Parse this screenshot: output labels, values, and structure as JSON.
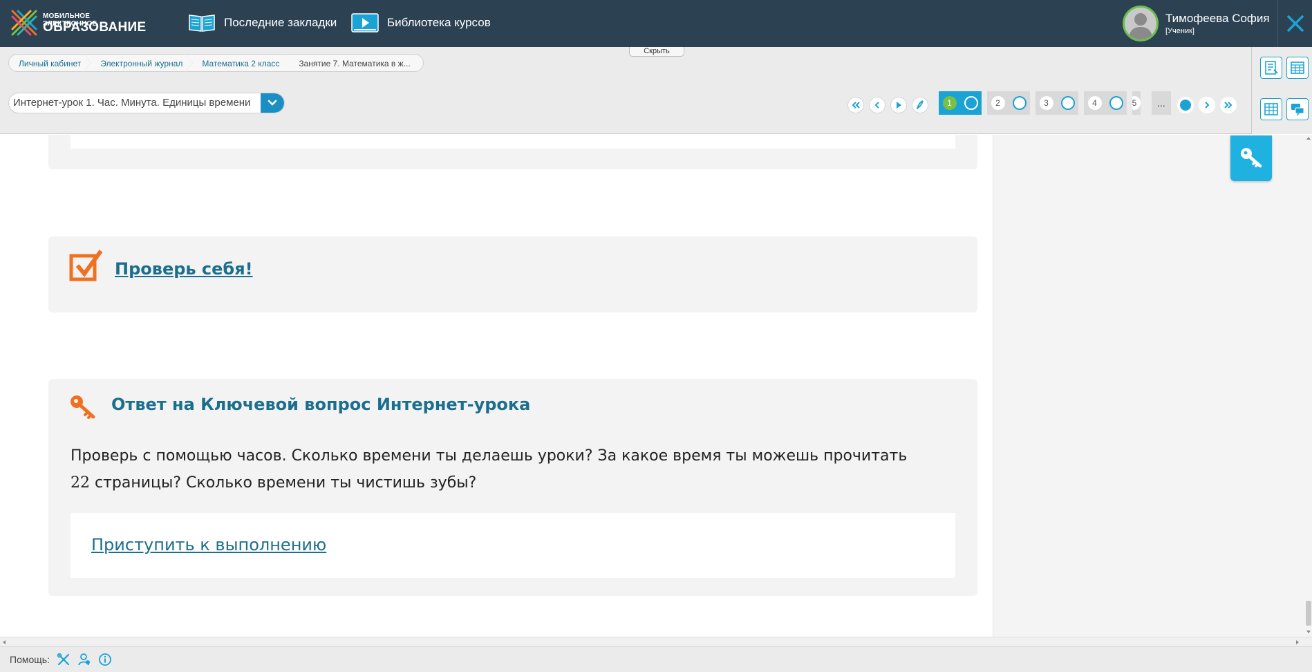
{
  "header": {
    "logo_line1": "МОБИЛЬНОЕ ЭЛЕКТРОННОЕ",
    "logo_line2": "ОБРАЗОВАНИЕ",
    "nav": [
      {
        "label": "Последние закладки",
        "icon": "book-icon"
      },
      {
        "label": "Библиотека курсов",
        "icon": "video-icon"
      }
    ],
    "user": {
      "name": "Тимофеева София",
      "role": "[Ученик]"
    }
  },
  "subbar": {
    "hide_label": "Скрыть",
    "breadcrumb": [
      "Личный кабинет",
      "Электронный журнал",
      "Математика 2 класс",
      "Занятие 7. Математика в ж..."
    ],
    "lesson_select": "Интернет-урок 1. Час. Минута. Единицы времени",
    "pages": [
      {
        "num": "1",
        "active": true
      },
      {
        "num": "2",
        "active": false
      },
      {
        "num": "3",
        "active": false
      },
      {
        "num": "4",
        "active": false
      },
      {
        "num": "5",
        "active": false
      }
    ],
    "more_label": "..."
  },
  "content": {
    "check_title": "Проверь себя!",
    "key_title": "Ответ на Ключевой вопрос Интернет-урока",
    "key_text_line1": "Проверь с помощью часов. Сколько времени ты делаешь уроки? За какое время ты можешь прочитать",
    "key_text_line2_num": "22",
    "key_text_line2": " страницы? Сколько времени ты чистишь зубы?",
    "begin_link": "Приступить к выполнению"
  },
  "footer": {
    "help_label": "Помощь:"
  },
  "colors": {
    "header_bg": "#2c4252",
    "accent_blue": "#1ba3d4",
    "link_teal": "#1b6f8d",
    "orange": "#f07022",
    "green": "#7ac143"
  }
}
